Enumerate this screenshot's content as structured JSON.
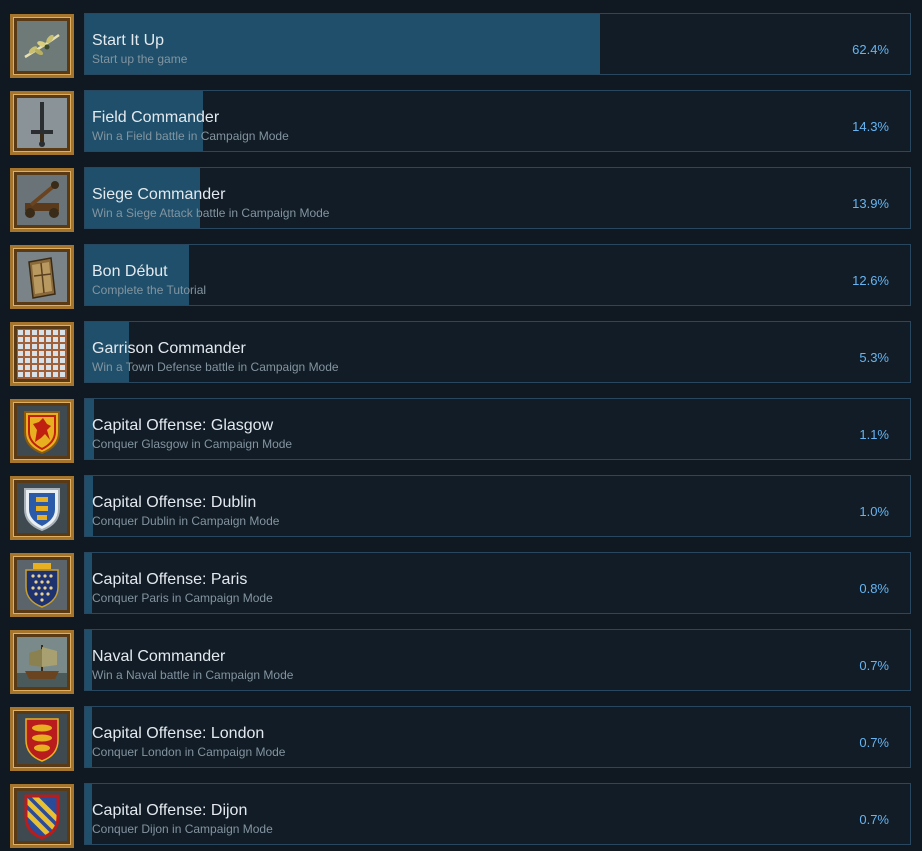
{
  "achievements": [
    {
      "name": "Start It Up",
      "description": "Start up the game",
      "percent_label": "62.4%",
      "percent": 62.4,
      "icon": "olive-branch-icon"
    },
    {
      "name": "Field Commander",
      "description": "Win a Field battle in Campaign Mode",
      "percent_label": "14.3%",
      "percent": 14.3,
      "icon": "sword-icon"
    },
    {
      "name": "Siege Commander",
      "description": "Win a Siege Attack battle in Campaign Mode",
      "percent_label": "13.9%",
      "percent": 13.9,
      "icon": "catapult-icon"
    },
    {
      "name": "Bon Début",
      "description": "Complete the Tutorial",
      "percent_label": "12.6%",
      "percent": 12.6,
      "icon": "book-icon"
    },
    {
      "name": "Garrison Commander",
      "description": "Win a Town Defense battle in Campaign Mode",
      "percent_label": "5.3%",
      "percent": 5.3,
      "icon": "town-grid-icon"
    },
    {
      "name": "Capital Offense: Glasgow",
      "description": "Conquer Glasgow in Campaign Mode",
      "percent_label": "1.1%",
      "percent": 1.1,
      "icon": "scotland-lion-shield-icon"
    },
    {
      "name": "Capital Offense: Dublin",
      "description": "Conquer Dublin in Campaign Mode",
      "percent_label": "1.0%",
      "percent": 1.0,
      "icon": "ireland-crowns-shield-icon"
    },
    {
      "name": "Capital Offense: Paris",
      "description": "Conquer Paris in Campaign Mode",
      "percent_label": "0.8%",
      "percent": 0.8,
      "icon": "france-fleur-shield-icon"
    },
    {
      "name": "Naval Commander",
      "description": "Win a Naval battle in Campaign Mode",
      "percent_label": "0.7%",
      "percent": 0.7,
      "icon": "ship-icon"
    },
    {
      "name": "Capital Offense: London",
      "description": "Conquer London in Campaign Mode",
      "percent_label": "0.7%",
      "percent": 0.7,
      "icon": "england-lions-shield-icon"
    },
    {
      "name": "Capital Offense: Dijon",
      "description": "Conquer Dijon in Campaign Mode",
      "percent_label": "0.7%",
      "percent": 0.7,
      "icon": "burgundy-shield-icon"
    }
  ]
}
